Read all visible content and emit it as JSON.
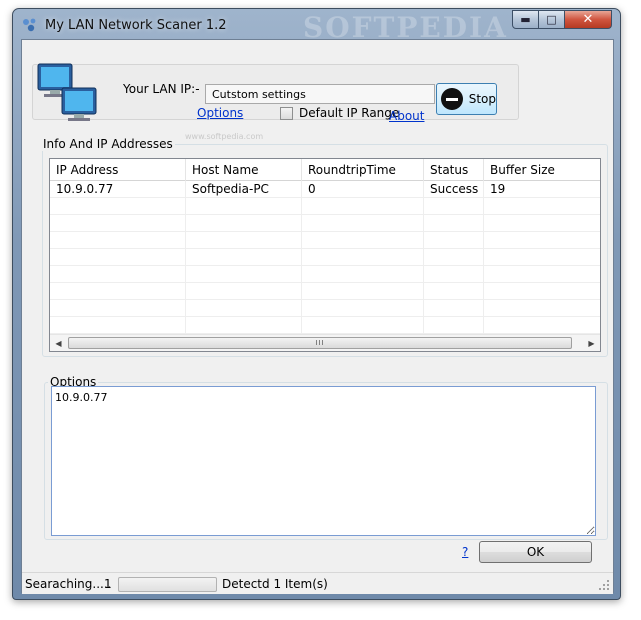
{
  "window": {
    "title": "My LAN Network Scaner 1.2",
    "watermark": "SOFTPEDIA",
    "min_glyph": "▬",
    "max_glyph": "□",
    "close_glyph": "✕"
  },
  "top": {
    "lan_ip_label": "Your LAN IP:-",
    "lan_ip_value": "Cutstom settings",
    "options_link": "Options",
    "ghost_text": "www.softpedia.com",
    "default_range_label": "Default IP Range",
    "default_range_checked": false,
    "about_link": "About",
    "stop_label": "Stop"
  },
  "info_group": {
    "title": "Info And IP Addresses",
    "columns": [
      "IP Address",
      "Host Name",
      "RoundtripTime",
      "Status",
      "Buffer Size"
    ],
    "rows": [
      [
        "10.9.0.77",
        "Softpedia-PC",
        "0",
        "Success",
        "19"
      ]
    ],
    "scroll_left": "◀",
    "scroll_right": "▶",
    "scroll_grip": "III"
  },
  "options_group": {
    "title": "Options",
    "text": "10.9.0.77"
  },
  "help_link": "?",
  "ok_label": "OK",
  "status": {
    "searching": "Searaching.....",
    "count": "1",
    "progress": 0.0,
    "detected": "Detectd 1 Item(s)"
  }
}
